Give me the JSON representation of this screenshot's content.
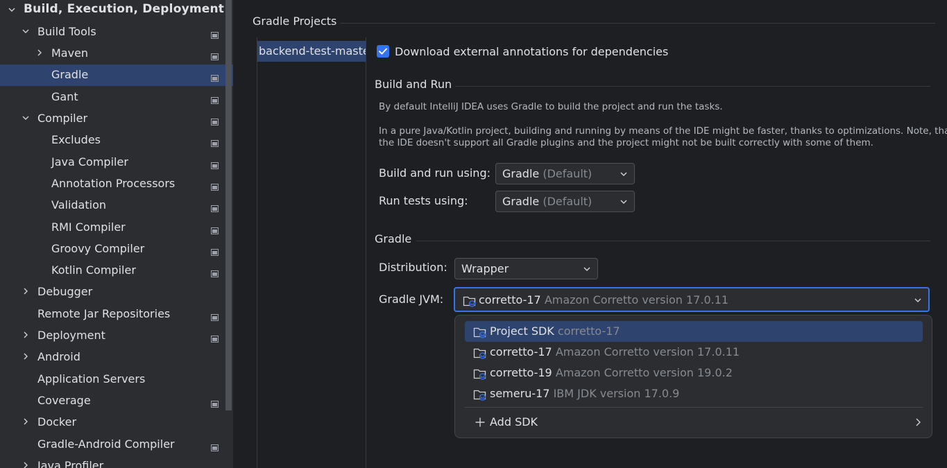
{
  "sidebar": {
    "items": [
      {
        "label": "Build, Execution, Deployment",
        "level": 0,
        "chevron": "down",
        "proj_icon": false,
        "selected": false,
        "bold": true
      },
      {
        "label": "Build Tools",
        "level": 1,
        "chevron": "down",
        "proj_icon": true,
        "selected": false
      },
      {
        "label": "Maven",
        "level": 2,
        "chevron": "right",
        "proj_icon": true,
        "selected": false
      },
      {
        "label": "Gradle",
        "level": 2,
        "chevron": "none",
        "proj_icon": true,
        "selected": true
      },
      {
        "label": "Gant",
        "level": 2,
        "chevron": "none",
        "proj_icon": true,
        "selected": false
      },
      {
        "label": "Compiler",
        "level": 1,
        "chevron": "down",
        "proj_icon": true,
        "selected": false
      },
      {
        "label": "Excludes",
        "level": 2,
        "chevron": "none",
        "proj_icon": true,
        "selected": false
      },
      {
        "label": "Java Compiler",
        "level": 2,
        "chevron": "none",
        "proj_icon": true,
        "selected": false
      },
      {
        "label": "Annotation Processors",
        "level": 2,
        "chevron": "none",
        "proj_icon": true,
        "selected": false
      },
      {
        "label": "Validation",
        "level": 2,
        "chevron": "none",
        "proj_icon": true,
        "selected": false
      },
      {
        "label": "RMI Compiler",
        "level": 2,
        "chevron": "none",
        "proj_icon": true,
        "selected": false
      },
      {
        "label": "Groovy Compiler",
        "level": 2,
        "chevron": "none",
        "proj_icon": true,
        "selected": false
      },
      {
        "label": "Kotlin Compiler",
        "level": 2,
        "chevron": "none",
        "proj_icon": true,
        "selected": false
      },
      {
        "label": "Debugger",
        "level": 1,
        "chevron": "right",
        "proj_icon": false,
        "selected": false
      },
      {
        "label": "Remote Jar Repositories",
        "level": 1,
        "chevron": "none",
        "proj_icon": true,
        "selected": false
      },
      {
        "label": "Deployment",
        "level": 1,
        "chevron": "right",
        "proj_icon": true,
        "selected": false
      },
      {
        "label": "Android",
        "level": 1,
        "chevron": "right",
        "proj_icon": false,
        "selected": false
      },
      {
        "label": "Application Servers",
        "level": 1,
        "chevron": "none",
        "proj_icon": false,
        "selected": false
      },
      {
        "label": "Coverage",
        "level": 1,
        "chevron": "none",
        "proj_icon": true,
        "selected": false
      },
      {
        "label": "Docker",
        "level": 1,
        "chevron": "right",
        "proj_icon": false,
        "selected": false
      },
      {
        "label": "Gradle-Android Compiler",
        "level": 1,
        "chevron": "none",
        "proj_icon": true,
        "selected": false
      },
      {
        "label": "Java Profiler",
        "level": 1,
        "chevron": "right",
        "proj_icon": false,
        "selected": false
      }
    ]
  },
  "main": {
    "gradle_projects_title": "Gradle Projects",
    "project_name": "backend-test-maste",
    "download_annotations": {
      "label": "Download external annotations for dependencies",
      "checked": true
    },
    "build_and_run": {
      "title": "Build and Run",
      "desc1": "By default IntelliJ IDEA uses Gradle to build the project and run the tasks.",
      "desc2_line1": "In a pure Java/Kotlin project, building and running by means of the IDE might be faster, thanks to optimizations. Note, that",
      "desc2_line2": "the IDE doesn't support all Gradle plugins and the project might not be built correctly with some of them.",
      "build_run_label": "Build and run using:",
      "build_run_value": "Gradle",
      "build_run_suffix": "(Default)",
      "run_tests_label": "Run tests using:",
      "run_tests_value": "Gradle",
      "run_tests_suffix": "(Default)"
    },
    "gradle": {
      "title": "Gradle",
      "distribution_label": "Distribution:",
      "distribution_value": "Wrapper",
      "jvm_label": "Gradle JVM:",
      "jvm_value": "corretto-17",
      "jvm_detail": "Amazon Corretto version 17.0.11"
    }
  },
  "popup": {
    "items": [
      {
        "name": "Project SDK",
        "detail": "corretto-17",
        "selected": true
      },
      {
        "name": "corretto-17",
        "detail": "Amazon Corretto version 17.0.11",
        "selected": false
      },
      {
        "name": "corretto-19",
        "detail": "Amazon Corretto version 19.0.2",
        "selected": false
      },
      {
        "name": "semeru-17",
        "detail": "IBM JDK version 17.0.9",
        "selected": false
      }
    ],
    "add_sdk_label": "Add SDK"
  },
  "colors": {
    "accent": "#3574f0",
    "selection": "#2e436e",
    "background_panel": "#1e1f22",
    "background_sidebar": "#2b2d30"
  }
}
